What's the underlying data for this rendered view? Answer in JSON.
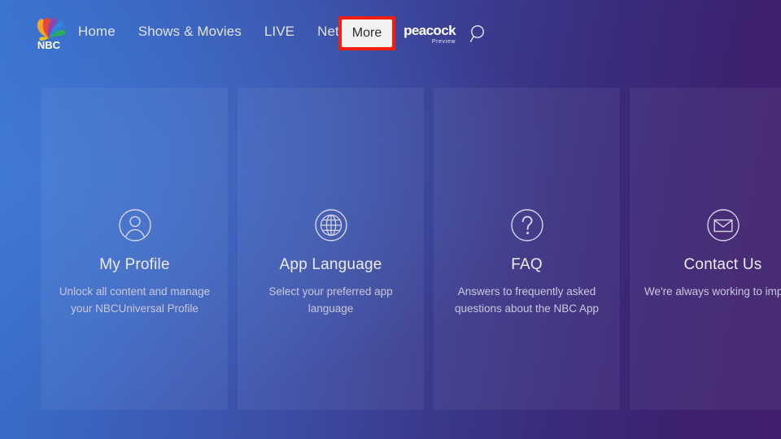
{
  "app": {
    "brand_logo": "nbc-peacock-logo",
    "brand_text": "NBC",
    "partner_brand": "peacock",
    "partner_sub": "Preview"
  },
  "nav": {
    "items": [
      {
        "label": "Home",
        "name": "nav-item-home"
      },
      {
        "label": "Shows & Movies",
        "name": "nav-item-shows-movies"
      },
      {
        "label": "LIVE",
        "name": "nav-item-live"
      },
      {
        "label": "Networks",
        "name": "nav-item-networks"
      }
    ],
    "selected": {
      "label": "More",
      "highlight_color": "#f01f10",
      "background": "#f2f2f0",
      "text_color": "#2b2b2b"
    },
    "search_icon": "search-icon"
  },
  "cards": [
    {
      "icon": "user-circle-icon",
      "title": "My Profile",
      "desc": "Unlock all content and manage your NBCUniversal Profile"
    },
    {
      "icon": "globe-icon",
      "title": "App Language",
      "desc": "Select your preferred app language"
    },
    {
      "icon": "question-mark-icon",
      "title": "FAQ",
      "desc": "Answers to frequently asked questions about the NBC App"
    },
    {
      "icon": "envelope-icon",
      "title": "Contact Us",
      "desc": "We're always working to improve the NBC App, and we want your feedback!"
    }
  ],
  "colors": {
    "background_left": "#3a71cf",
    "background_right": "#401f6d",
    "card_fill": "rgba(255,255,255,0.055)",
    "title_text": "#eceaf6",
    "desc_text": "#c9c7dd",
    "nav_text": "#dfe3ee"
  }
}
